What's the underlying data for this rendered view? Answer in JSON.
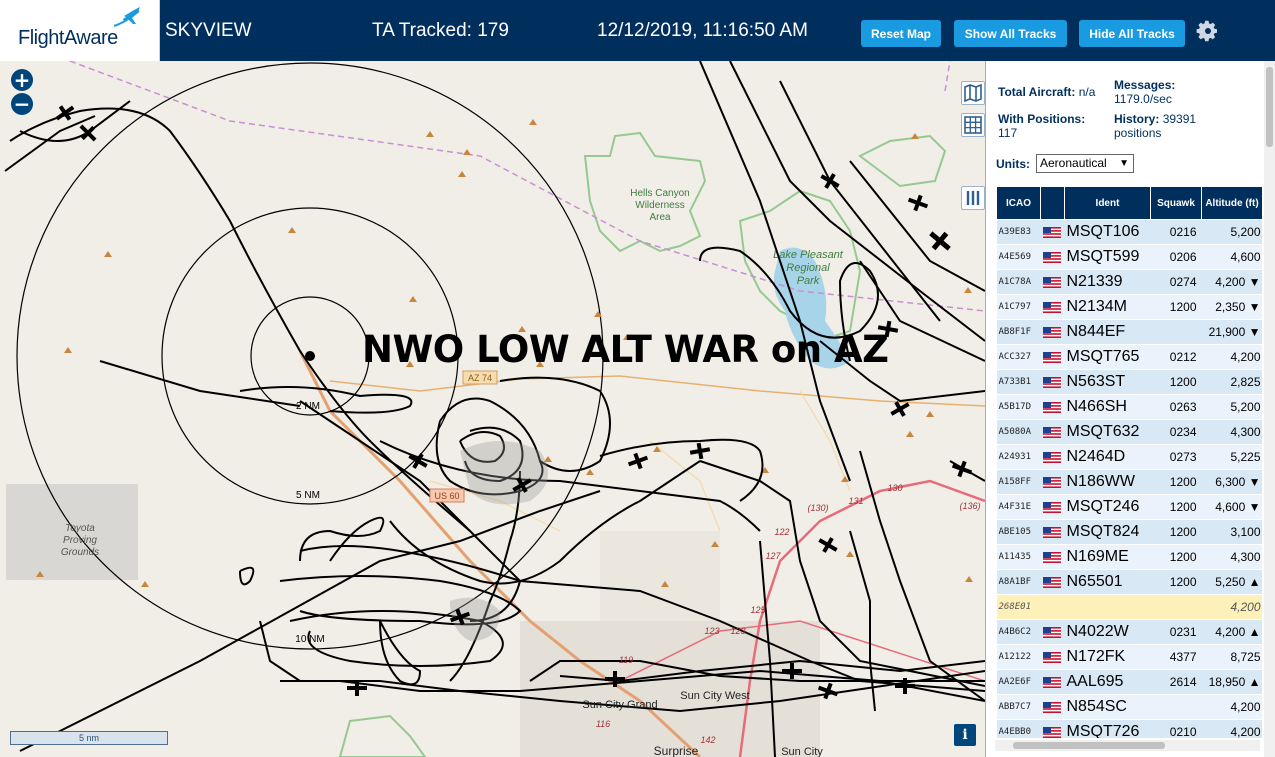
{
  "header": {
    "logo": "FlightAware",
    "site_title": "SKYVIEW",
    "tracked": "TA Tracked: 179",
    "datetime": "12/12/2019, 11:16:50 AM",
    "buttons": {
      "reset": "Reset Map",
      "show": "Show All Tracks",
      "hide": "Hide All Tracks"
    }
  },
  "map": {
    "overlay_text": "NWO LOW ALT WAR  on AZ",
    "zoom_in": "+",
    "zoom_out": "−",
    "scale": "5 nm",
    "info": "i",
    "labels": {
      "hells_canyon": [
        "Hells Canyon",
        "Wilderness",
        "Area"
      ],
      "lake_pleasant": [
        "Lake Pleasant",
        "Regional",
        "Park"
      ],
      "toyota": [
        "Toyota",
        "Proving",
        "Grounds"
      ],
      "ring_2": "2 NM",
      "ring_5": "5 NM",
      "ring_10": "10 NM",
      "sun_city_grand": "Sun City Grand",
      "sun_city_west": "Sun City West",
      "surprise": "Surprise",
      "sun_city": "Sun City",
      "us60": "US 60",
      "az74": "AZ 74"
    },
    "route_numbers": [
      "131",
      "130",
      "(130)",
      "(136)",
      "122",
      "127",
      "125",
      "123",
      "123",
      "119",
      "116",
      "142"
    ]
  },
  "sidebar": {
    "total_label": "Total Aircraft:",
    "total_value": "n/a",
    "messages_label": "Messages:",
    "messages_value": "1179.0/sec",
    "positions_label": "With Positions:",
    "positions_value": "117",
    "history_label": "History:",
    "history_value": "39391",
    "history_unit": "positions",
    "units_label": "Units:",
    "units_value": "Aeronautical",
    "table_headers": {
      "icao": "ICAO",
      "ident": "Ident",
      "squawk": "Squawk",
      "altitude": "Altitude (ft)"
    },
    "rows": [
      {
        "icao": "A39E83",
        "flag": true,
        "ident": "MSQT106",
        "squawk": "0216",
        "altitude": "5,200",
        "hl": false
      },
      {
        "icao": "A4E569",
        "flag": true,
        "ident": "MSQT599",
        "squawk": "0206",
        "altitude": "4,600",
        "hl": false
      },
      {
        "icao": "A1C78A",
        "flag": true,
        "ident": "N21339",
        "squawk": "0274",
        "altitude": "4,200 ▼",
        "hl": false
      },
      {
        "icao": "A1C797",
        "flag": true,
        "ident": "N2134M",
        "squawk": "1200",
        "altitude": "2,350 ▼",
        "hl": false
      },
      {
        "icao": "AB8F1F",
        "flag": true,
        "ident": "N844EF",
        "squawk": "",
        "altitude": "21,900 ▼",
        "hl": false
      },
      {
        "icao": "ACC327",
        "flag": true,
        "ident": "MSQT765",
        "squawk": "0212",
        "altitude": "4,200",
        "hl": false
      },
      {
        "icao": "A733B1",
        "flag": true,
        "ident": "N563ST",
        "squawk": "1200",
        "altitude": "2,825",
        "hl": false
      },
      {
        "icao": "A5B17D",
        "flag": true,
        "ident": "N466SH",
        "squawk": "0263",
        "altitude": "5,200",
        "hl": false
      },
      {
        "icao": "A5080A",
        "flag": true,
        "ident": "MSQT632",
        "squawk": "0234",
        "altitude": "4,300",
        "hl": false
      },
      {
        "icao": "A24931",
        "flag": true,
        "ident": "N2464D",
        "squawk": "0273",
        "altitude": "5,225",
        "hl": false
      },
      {
        "icao": "A158FF",
        "flag": true,
        "ident": "N186WW",
        "squawk": "1200",
        "altitude": "6,300 ▼",
        "hl": false
      },
      {
        "icao": "A4F31E",
        "flag": true,
        "ident": "MSQT246",
        "squawk": "1200",
        "altitude": "4,600 ▼",
        "hl": false
      },
      {
        "icao": "ABE105",
        "flag": true,
        "ident": "MSQT824",
        "squawk": "1200",
        "altitude": "3,100",
        "hl": false
      },
      {
        "icao": "A11435",
        "flag": true,
        "ident": "N169ME",
        "squawk": "1200",
        "altitude": "4,300",
        "hl": false
      },
      {
        "icao": "A8A1BF",
        "flag": true,
        "ident": "N65501",
        "squawk": "1200",
        "altitude": "5,250 ▲",
        "hl": false
      },
      {
        "icao": "268E01",
        "flag": false,
        "ident": "",
        "squawk": "",
        "altitude": "4,200",
        "hl": true
      },
      {
        "icao": "A4B6C2",
        "flag": true,
        "ident": "N4022W",
        "squawk": "0231",
        "altitude": "4,200 ▲",
        "hl": false
      },
      {
        "icao": "A12122",
        "flag": true,
        "ident": "N172FK",
        "squawk": "4377",
        "altitude": "8,725",
        "hl": false
      },
      {
        "icao": "AA2E6F",
        "flag": true,
        "ident": "AAL695",
        "squawk": "2614",
        "altitude": "18,950 ▲",
        "hl": false
      },
      {
        "icao": "ABB7C7",
        "flag": true,
        "ident": "N854SC",
        "squawk": "",
        "altitude": "4,200",
        "hl": false
      },
      {
        "icao": "A4EBB0",
        "flag": true,
        "ident": "MSQT726",
        "squawk": "0210",
        "altitude": "4,200",
        "hl": false
      }
    ]
  },
  "icons": [
    "flightaware-plane-icon",
    "gear-icon",
    "map-layers-icon",
    "grid-icon",
    "columns-icon",
    "us-flag-icon",
    "aircraft-icon",
    "peak-icon"
  ],
  "colors": {
    "header_bg": "#002f5d",
    "button_bg": "#1a9ae0",
    "map_bg": "#f1eee7",
    "park_green": "#86c28a",
    "water": "#a8d4ea",
    "track": "#000000",
    "table_row_a": "#d9e8f5",
    "table_row_b": "#eaf3fb",
    "table_highlight": "#fdf0b8"
  }
}
